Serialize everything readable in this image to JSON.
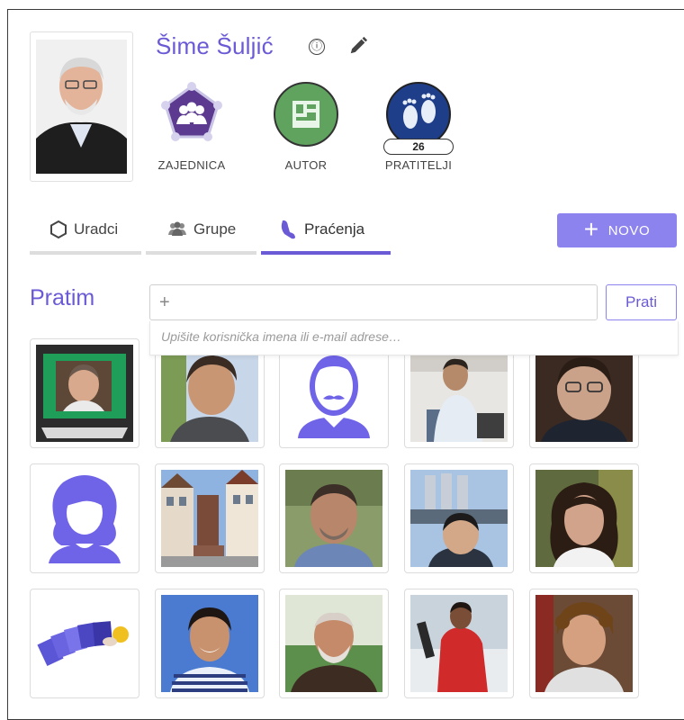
{
  "profile": {
    "name": "Šime Šuljić",
    "info_icon": "ⓘ",
    "badges": [
      {
        "label": "ZAJEDNICA",
        "icon": "community-icon"
      },
      {
        "label": "AUTOR",
        "icon": "author-icon"
      },
      {
        "label": "PRATITELJI",
        "icon": "followers-icon",
        "count": "26"
      }
    ]
  },
  "tabs": [
    {
      "label": "Uradci",
      "icon": "hexagon-icon"
    },
    {
      "label": "Grupe",
      "icon": "group-icon"
    },
    {
      "label": "Praćenja",
      "icon": "footprint-icon",
      "active": true
    }
  ],
  "new_button": {
    "label": "NOVO"
  },
  "following": {
    "title": "Pratim",
    "input_prefix": "+",
    "input_value": "",
    "hint": "Upišite korisnička imena ili e-mail adrese…",
    "follow_button": "Prati"
  },
  "colors": {
    "accent": "#6a5ad6",
    "button": "#8d83ee",
    "community": "#5b3a8f",
    "author": "#5fa35f",
    "followers": "#1f3e8a"
  }
}
